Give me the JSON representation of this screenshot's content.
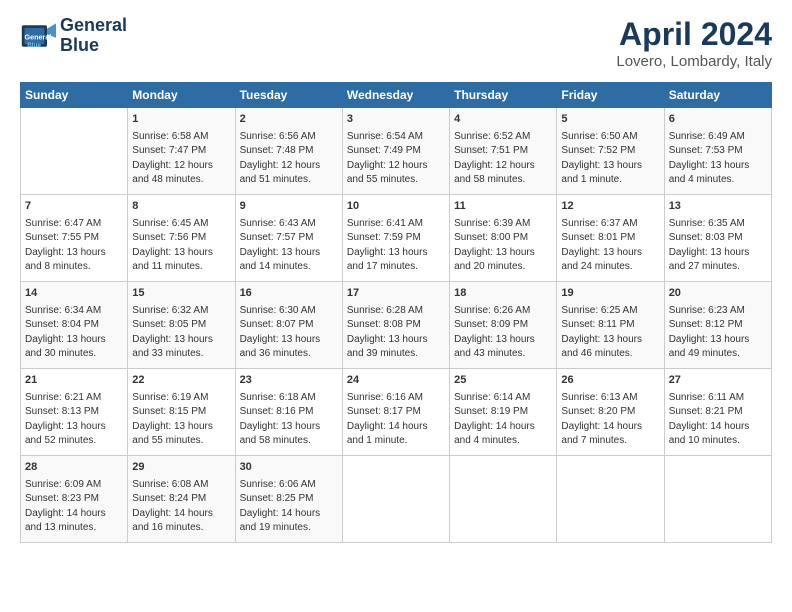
{
  "logo": {
    "line1": "General",
    "line2": "Blue"
  },
  "title": "April 2024",
  "subtitle": "Lovero, Lombardy, Italy",
  "days_header": [
    "Sunday",
    "Monday",
    "Tuesday",
    "Wednesday",
    "Thursday",
    "Friday",
    "Saturday"
  ],
  "weeks": [
    [
      {
        "day": "",
        "info": ""
      },
      {
        "day": "1",
        "info": "Sunrise: 6:58 AM\nSunset: 7:47 PM\nDaylight: 12 hours\nand 48 minutes."
      },
      {
        "day": "2",
        "info": "Sunrise: 6:56 AM\nSunset: 7:48 PM\nDaylight: 12 hours\nand 51 minutes."
      },
      {
        "day": "3",
        "info": "Sunrise: 6:54 AM\nSunset: 7:49 PM\nDaylight: 12 hours\nand 55 minutes."
      },
      {
        "day": "4",
        "info": "Sunrise: 6:52 AM\nSunset: 7:51 PM\nDaylight: 12 hours\nand 58 minutes."
      },
      {
        "day": "5",
        "info": "Sunrise: 6:50 AM\nSunset: 7:52 PM\nDaylight: 13 hours\nand 1 minute."
      },
      {
        "day": "6",
        "info": "Sunrise: 6:49 AM\nSunset: 7:53 PM\nDaylight: 13 hours\nand 4 minutes."
      }
    ],
    [
      {
        "day": "7",
        "info": "Sunrise: 6:47 AM\nSunset: 7:55 PM\nDaylight: 13 hours\nand 8 minutes."
      },
      {
        "day": "8",
        "info": "Sunrise: 6:45 AM\nSunset: 7:56 PM\nDaylight: 13 hours\nand 11 minutes."
      },
      {
        "day": "9",
        "info": "Sunrise: 6:43 AM\nSunset: 7:57 PM\nDaylight: 13 hours\nand 14 minutes."
      },
      {
        "day": "10",
        "info": "Sunrise: 6:41 AM\nSunset: 7:59 PM\nDaylight: 13 hours\nand 17 minutes."
      },
      {
        "day": "11",
        "info": "Sunrise: 6:39 AM\nSunset: 8:00 PM\nDaylight: 13 hours\nand 20 minutes."
      },
      {
        "day": "12",
        "info": "Sunrise: 6:37 AM\nSunset: 8:01 PM\nDaylight: 13 hours\nand 24 minutes."
      },
      {
        "day": "13",
        "info": "Sunrise: 6:35 AM\nSunset: 8:03 PM\nDaylight: 13 hours\nand 27 minutes."
      }
    ],
    [
      {
        "day": "14",
        "info": "Sunrise: 6:34 AM\nSunset: 8:04 PM\nDaylight: 13 hours\nand 30 minutes."
      },
      {
        "day": "15",
        "info": "Sunrise: 6:32 AM\nSunset: 8:05 PM\nDaylight: 13 hours\nand 33 minutes."
      },
      {
        "day": "16",
        "info": "Sunrise: 6:30 AM\nSunset: 8:07 PM\nDaylight: 13 hours\nand 36 minutes."
      },
      {
        "day": "17",
        "info": "Sunrise: 6:28 AM\nSunset: 8:08 PM\nDaylight: 13 hours\nand 39 minutes."
      },
      {
        "day": "18",
        "info": "Sunrise: 6:26 AM\nSunset: 8:09 PM\nDaylight: 13 hours\nand 43 minutes."
      },
      {
        "day": "19",
        "info": "Sunrise: 6:25 AM\nSunset: 8:11 PM\nDaylight: 13 hours\nand 46 minutes."
      },
      {
        "day": "20",
        "info": "Sunrise: 6:23 AM\nSunset: 8:12 PM\nDaylight: 13 hours\nand 49 minutes."
      }
    ],
    [
      {
        "day": "21",
        "info": "Sunrise: 6:21 AM\nSunset: 8:13 PM\nDaylight: 13 hours\nand 52 minutes."
      },
      {
        "day": "22",
        "info": "Sunrise: 6:19 AM\nSunset: 8:15 PM\nDaylight: 13 hours\nand 55 minutes."
      },
      {
        "day": "23",
        "info": "Sunrise: 6:18 AM\nSunset: 8:16 PM\nDaylight: 13 hours\nand 58 minutes."
      },
      {
        "day": "24",
        "info": "Sunrise: 6:16 AM\nSunset: 8:17 PM\nDaylight: 14 hours\nand 1 minute."
      },
      {
        "day": "25",
        "info": "Sunrise: 6:14 AM\nSunset: 8:19 PM\nDaylight: 14 hours\nand 4 minutes."
      },
      {
        "day": "26",
        "info": "Sunrise: 6:13 AM\nSunset: 8:20 PM\nDaylight: 14 hours\nand 7 minutes."
      },
      {
        "day": "27",
        "info": "Sunrise: 6:11 AM\nSunset: 8:21 PM\nDaylight: 14 hours\nand 10 minutes."
      }
    ],
    [
      {
        "day": "28",
        "info": "Sunrise: 6:09 AM\nSunset: 8:23 PM\nDaylight: 14 hours\nand 13 minutes."
      },
      {
        "day": "29",
        "info": "Sunrise: 6:08 AM\nSunset: 8:24 PM\nDaylight: 14 hours\nand 16 minutes."
      },
      {
        "day": "30",
        "info": "Sunrise: 6:06 AM\nSunset: 8:25 PM\nDaylight: 14 hours\nand 19 minutes."
      },
      {
        "day": "",
        "info": ""
      },
      {
        "day": "",
        "info": ""
      },
      {
        "day": "",
        "info": ""
      },
      {
        "day": "",
        "info": ""
      }
    ]
  ]
}
